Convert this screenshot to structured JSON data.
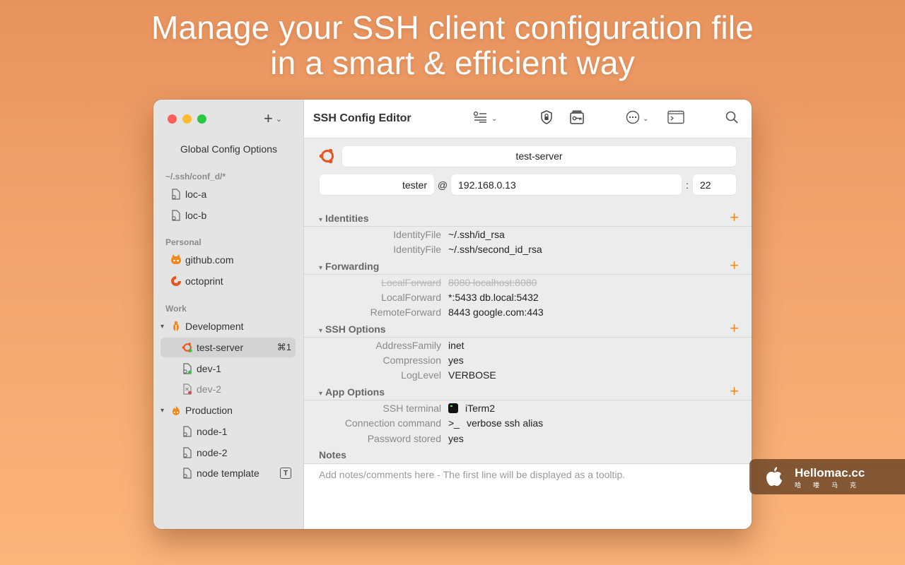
{
  "headline": {
    "line1": "Manage your SSH client configuration file",
    "line2": "in a smart & efficient way"
  },
  "sidebar": {
    "global_options": "Global Config Options",
    "sections": [
      {
        "label": "~/.ssh/conf_d/*",
        "items": [
          "loc-a",
          "loc-b"
        ]
      },
      {
        "label": "Personal",
        "items": [
          "github.com",
          "octoprint"
        ]
      },
      {
        "label": "Work"
      }
    ],
    "groups": {
      "development": {
        "label": "Development",
        "items": [
          "test-server",
          "dev-1",
          "dev-2"
        ],
        "selected_shortcut": "⌘1"
      },
      "production": {
        "label": "Production",
        "items": [
          "node-1",
          "node-2",
          "node template"
        ],
        "template_badge": "T"
      }
    }
  },
  "toolbar": {
    "title": "SSH Config Editor",
    "icons": [
      "list-settings-icon",
      "shield-icon",
      "key-icon",
      "more-icon",
      "terminal-icon",
      "search-icon"
    ]
  },
  "host": {
    "name": "test-server",
    "user": "tester",
    "at": "@",
    "address": "192.168.0.13",
    "colon": ":",
    "port": "22"
  },
  "sections": {
    "identities": {
      "title": "Identities",
      "rows": [
        {
          "key": "IdentityFile",
          "value": "~/.ssh/id_rsa"
        },
        {
          "key": "IdentityFile",
          "value": "~/.ssh/second_id_rsa"
        }
      ]
    },
    "forwarding": {
      "title": "Forwarding",
      "rows": [
        {
          "key": "LocalForward",
          "value": "8080 localhost:8080"
        },
        {
          "key": "LocalForward",
          "value": "*:5433 db.local:5432"
        },
        {
          "key": "RemoteForward",
          "value": "8443 google.com:443"
        }
      ]
    },
    "ssh_options": {
      "title": "SSH Options",
      "rows": [
        {
          "key": "AddressFamily",
          "value": "inet"
        },
        {
          "key": "Compression",
          "value": "yes"
        },
        {
          "key": "LogLevel",
          "value": "VERBOSE"
        }
      ]
    },
    "app_options": {
      "title": "App Options",
      "rows": [
        {
          "key": "SSH terminal",
          "value": "iTerm2"
        },
        {
          "key": "Connection command",
          "prefix": ">_",
          "value": "verbose ssh alias"
        },
        {
          "key": "Password stored",
          "value": "yes"
        }
      ]
    },
    "notes": {
      "title": "Notes",
      "placeholder": "Add notes/comments here - The first line will be displayed as a tooltip."
    }
  },
  "watermark": {
    "name": "Hellomac.cc",
    "sub": "哈喽马克"
  },
  "colors": {
    "accent": "#f08a1c",
    "ubuntu": "#e95420",
    "online": "#28c840",
    "offline": "#e0443e"
  }
}
